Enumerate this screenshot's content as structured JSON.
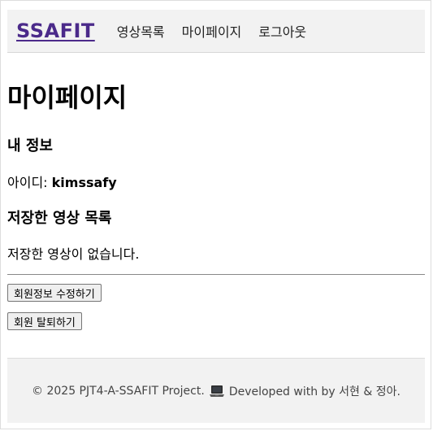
{
  "header": {
    "logo": "SSAFIT",
    "nav": [
      {
        "label": "영상목록"
      },
      {
        "label": "마이페이지"
      },
      {
        "label": "로그아웃"
      }
    ]
  },
  "main": {
    "title": "마이페이지",
    "my_info": {
      "heading": "내 정보",
      "id_label": "아이디: ",
      "id_value": "kimssafy"
    },
    "saved_videos": {
      "heading": "저장한 영상 목록",
      "empty_message": "저장한 영상이 없습니다."
    },
    "buttons": {
      "edit_profile": "회원정보 수정하기",
      "withdraw": "회원 탈퇴하기"
    }
  },
  "footer": {
    "text_before_icon": "© 2025 PJT4-A-SSAFIT Project.",
    "icon": "laptop-icon",
    "text_after_icon": "Developed with by 서현 & 정아."
  },
  "colors": {
    "logo": "#4b2a8a",
    "header_bg": "#f2f2f2",
    "footer_bg": "#f2f2f2"
  }
}
